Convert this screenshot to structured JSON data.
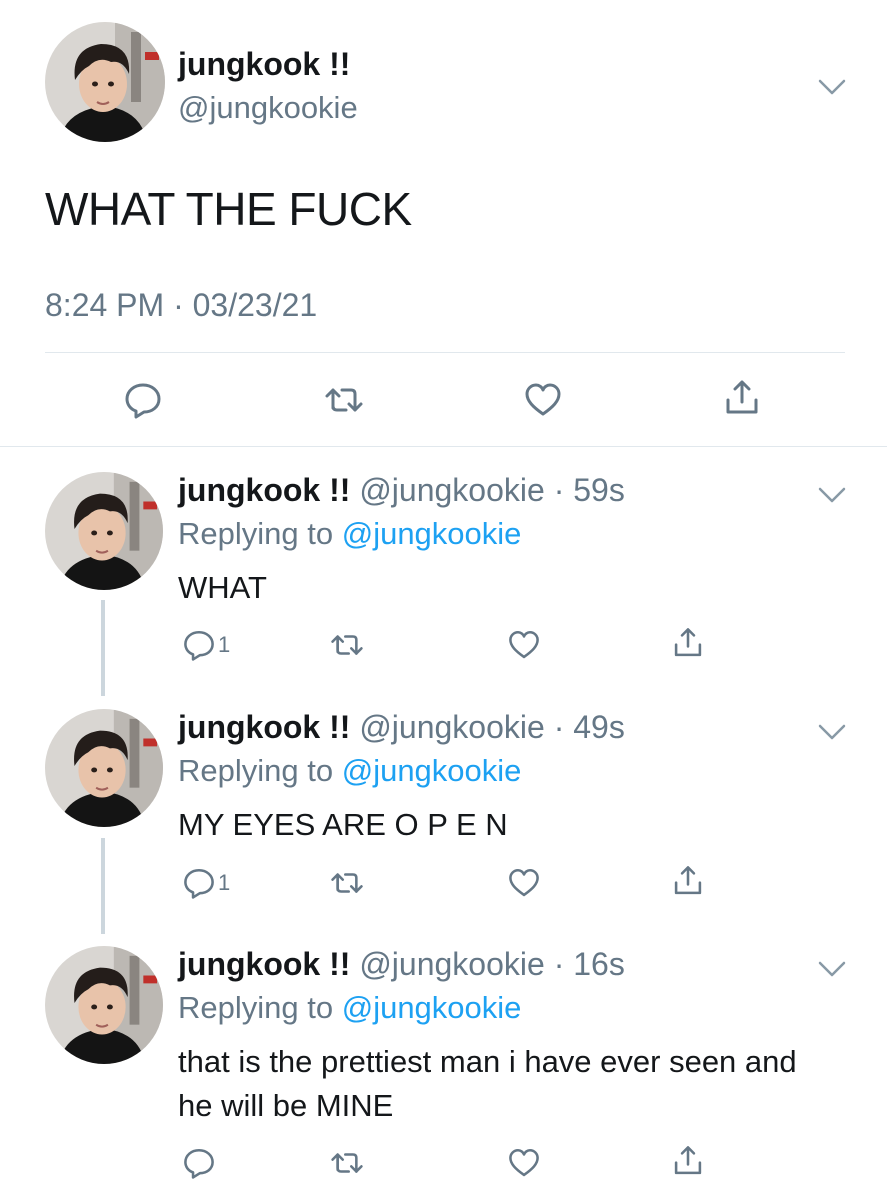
{
  "main_tweet": {
    "display_name": "jungkook !!",
    "handle": "@jungkookie",
    "text": "WHAT THE FUCK",
    "timestamp": "8:24 PM · 03/23/21",
    "actions": [
      "reply-icon",
      "retweet-icon",
      "like-icon",
      "share-icon"
    ]
  },
  "replies": [
    {
      "display_name": "jungkook !!",
      "meta": " @jungkookie · 59s",
      "replying_prefix": "Replying to ",
      "replying_to": "@jungkookie",
      "text": "WHAT",
      "reply_count": "1"
    },
    {
      "display_name": "jungkook !!",
      "meta": " @jungkookie · 49s",
      "replying_prefix": "Replying to ",
      "replying_to": "@jungkookie",
      "text": "MY EYES ARE O P E N",
      "reply_count": "1"
    },
    {
      "display_name": "jungkook !!",
      "meta": " @jungkookie · 16s",
      "replying_prefix": "Replying to ",
      "replying_to": "@jungkookie",
      "text": "that is the prettiest man i have ever seen and he will be MINE",
      "reply_count": ""
    }
  ],
  "colors": {
    "text": "#14171a",
    "secondary": "#657786",
    "link": "#1da1f2",
    "divider": "#e1e8ed",
    "thread_line": "#ccd6dd"
  }
}
